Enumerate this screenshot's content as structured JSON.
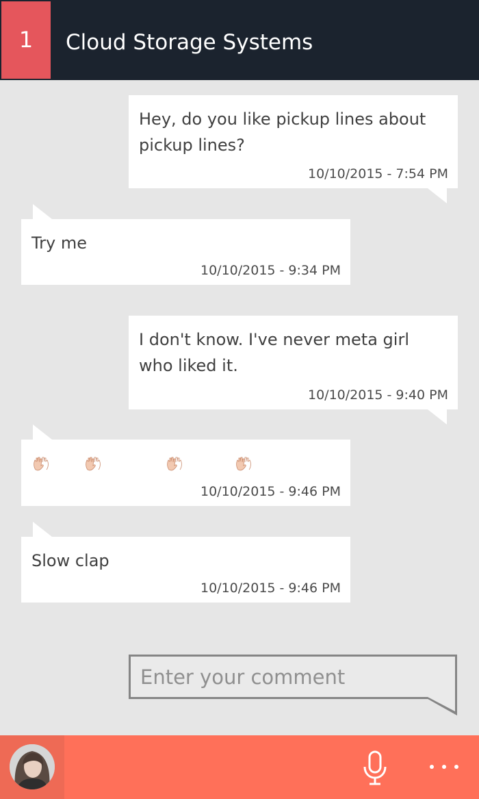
{
  "header": {
    "badge": "1",
    "title": "Cloud Storage Systems",
    "colors": {
      "background": "#1b232e",
      "badge": "#e5565c"
    }
  },
  "messages": [
    {
      "direction": "outgoing",
      "text": "Hey, do you like pickup lines about pickup lines?",
      "time": "10/10/2015 - 7:54 PM"
    },
    {
      "direction": "incoming",
      "text": "Try me",
      "time": "10/10/2015 - 9:34 PM"
    },
    {
      "direction": "outgoing",
      "text": "I don't know. I've never meta girl who liked it.",
      "time": "10/10/2015 - 9:40 PM"
    },
    {
      "direction": "incoming",
      "emoji": [
        "clapping-hands-icon",
        "clapping-hands-icon",
        "clapping-hands-icon",
        "clapping-hands-icon"
      ],
      "time": "10/10/2015 - 9:46 PM"
    },
    {
      "direction": "incoming",
      "text": "Slow clap",
      "time": "10/10/2015 - 9:46 PM"
    }
  ],
  "composer": {
    "placeholder": "Enter your comment",
    "value": ""
  },
  "bottom_bar": {
    "color": "#ff7059",
    "icons": [
      "avatar",
      "microphone-icon",
      "more-options-icon"
    ]
  }
}
